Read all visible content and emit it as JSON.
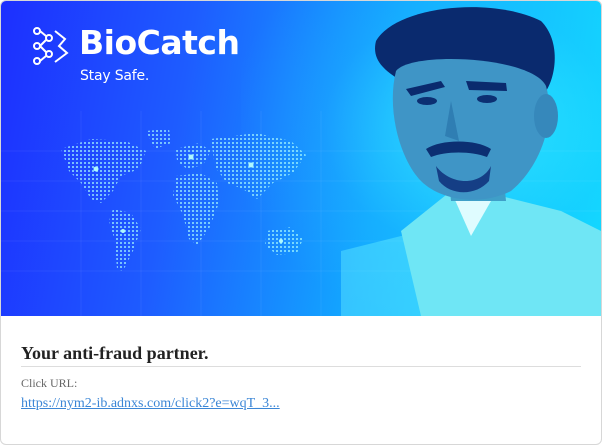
{
  "ad": {
    "brand_name": "BioCatch",
    "brand_tagline": "Stay Safe.",
    "brand_mark_icon": "biocatch-logo-mark-icon",
    "hero_image": "man-looking-at-tablet-photo",
    "map_image": "world-map-dots-graphic",
    "colors": {
      "banner_start": "#1d2fff",
      "banner_end": "#10dcff",
      "title_text": "#222222",
      "link": "#3b86d6"
    },
    "title": "Your anti-fraud partner.",
    "click_url_label": "Click URL:",
    "click_url": "https://nym2-ib.adnxs.com/click2?e=wqT_3..."
  }
}
